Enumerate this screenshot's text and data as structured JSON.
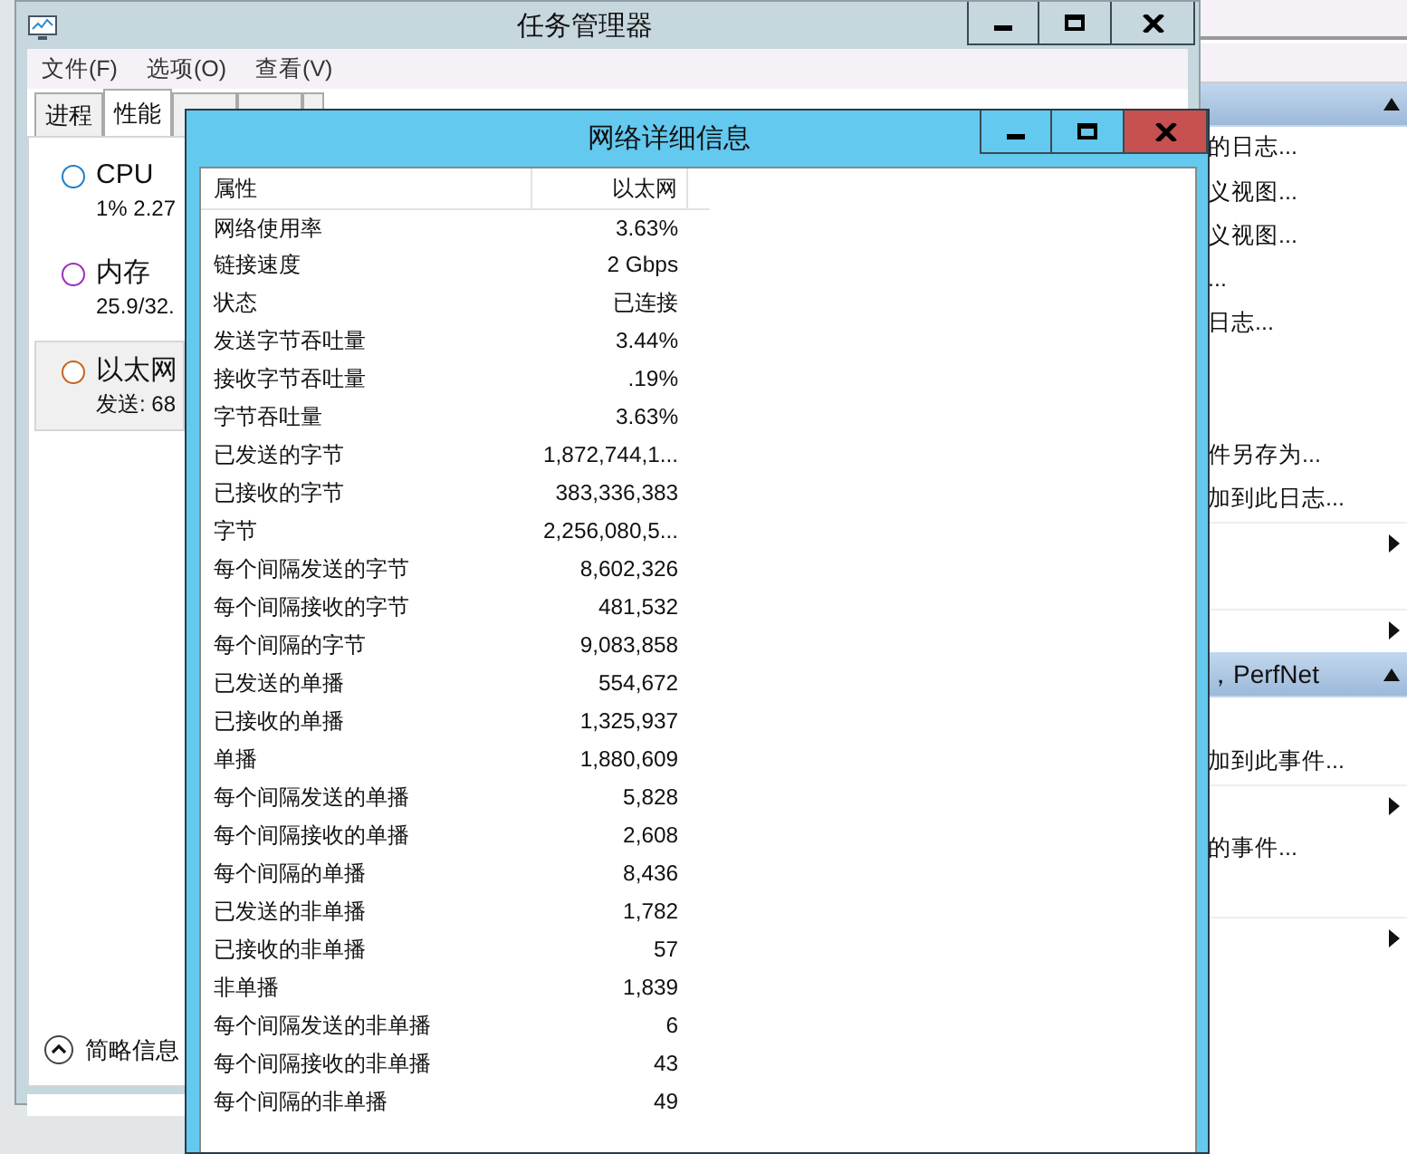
{
  "task_manager": {
    "title": "任务管理器",
    "menu": [
      "文件(F)",
      "选项(O)",
      "查看(V)"
    ],
    "tabs": [
      {
        "label": "进程",
        "selected": false
      },
      {
        "label": "性能",
        "selected": true
      },
      {
        "selected": false
      },
      {
        "selected": false
      },
      {
        "selected": false
      }
    ],
    "resources": [
      {
        "name": "CPU",
        "reading": "1% 2.27",
        "color": "#1e7fc8",
        "selected": false
      },
      {
        "name": "内存",
        "reading": "25.9/32.",
        "color": "#9b2fbd",
        "selected": false
      },
      {
        "name": "以太网",
        "reading": "发送: 68",
        "color": "#c6641f",
        "selected": true
      }
    ],
    "fewer_details": "简略信息"
  },
  "details_window": {
    "title": "网络详细信息",
    "columns": [
      "属性",
      "以太网"
    ],
    "rows": [
      [
        "网络使用率",
        "3.63%"
      ],
      [
        "链接速度",
        "2 Gbps"
      ],
      [
        "状态",
        "已连接"
      ],
      [
        "发送字节吞吐量",
        "3.44%"
      ],
      [
        "接收字节吞吐量",
        ".19%"
      ],
      [
        "字节吞吐量",
        "3.63%"
      ],
      [
        "已发送的字节",
        "1,872,744,1..."
      ],
      [
        "已接收的字节",
        "383,336,383"
      ],
      [
        "字节",
        "2,256,080,5..."
      ],
      [
        "每个间隔发送的字节",
        "8,602,326"
      ],
      [
        "每个间隔接收的字节",
        "481,532"
      ],
      [
        "每个间隔的字节",
        "9,083,858"
      ],
      [
        "已发送的单播",
        "554,672"
      ],
      [
        "已接收的单播",
        "1,325,937"
      ],
      [
        "单播",
        "1,880,609"
      ],
      [
        "每个间隔发送的单播",
        "5,828"
      ],
      [
        "每个间隔接收的单播",
        "2,608"
      ],
      [
        "每个间隔的单播",
        "8,436"
      ],
      [
        "已发送的非单播",
        "1,782"
      ],
      [
        "已接收的非单播",
        "57"
      ],
      [
        "非单播",
        "1,839"
      ],
      [
        "每个间隔发送的非单播",
        "6"
      ],
      [
        "每个间隔接收的非单播",
        "43"
      ],
      [
        "每个间隔的非单播",
        "49"
      ]
    ]
  },
  "actions_pane": {
    "items": [
      {
        "kind": "header"
      },
      {
        "kind": "link",
        "text": "的日志..."
      },
      {
        "kind": "link",
        "text": "义视图..."
      },
      {
        "kind": "link",
        "text": "义视图..."
      },
      {
        "kind": "link",
        "text": "..."
      },
      {
        "kind": "link",
        "text": "日志..."
      },
      {
        "kind": "blank"
      },
      {
        "kind": "blank"
      },
      {
        "kind": "link",
        "text": "件另存为..."
      },
      {
        "kind": "link",
        "text": "加到此日志..."
      },
      {
        "kind": "submenu"
      },
      {
        "kind": "blank"
      },
      {
        "kind": "submenu"
      },
      {
        "kind": "header",
        "text": "，PerfNet"
      },
      {
        "kind": "blank"
      },
      {
        "kind": "link",
        "text": "加到此事件..."
      },
      {
        "kind": "submenu"
      },
      {
        "kind": "link",
        "text": "的事件..."
      },
      {
        "kind": "blank"
      },
      {
        "kind": "submenu"
      }
    ]
  }
}
